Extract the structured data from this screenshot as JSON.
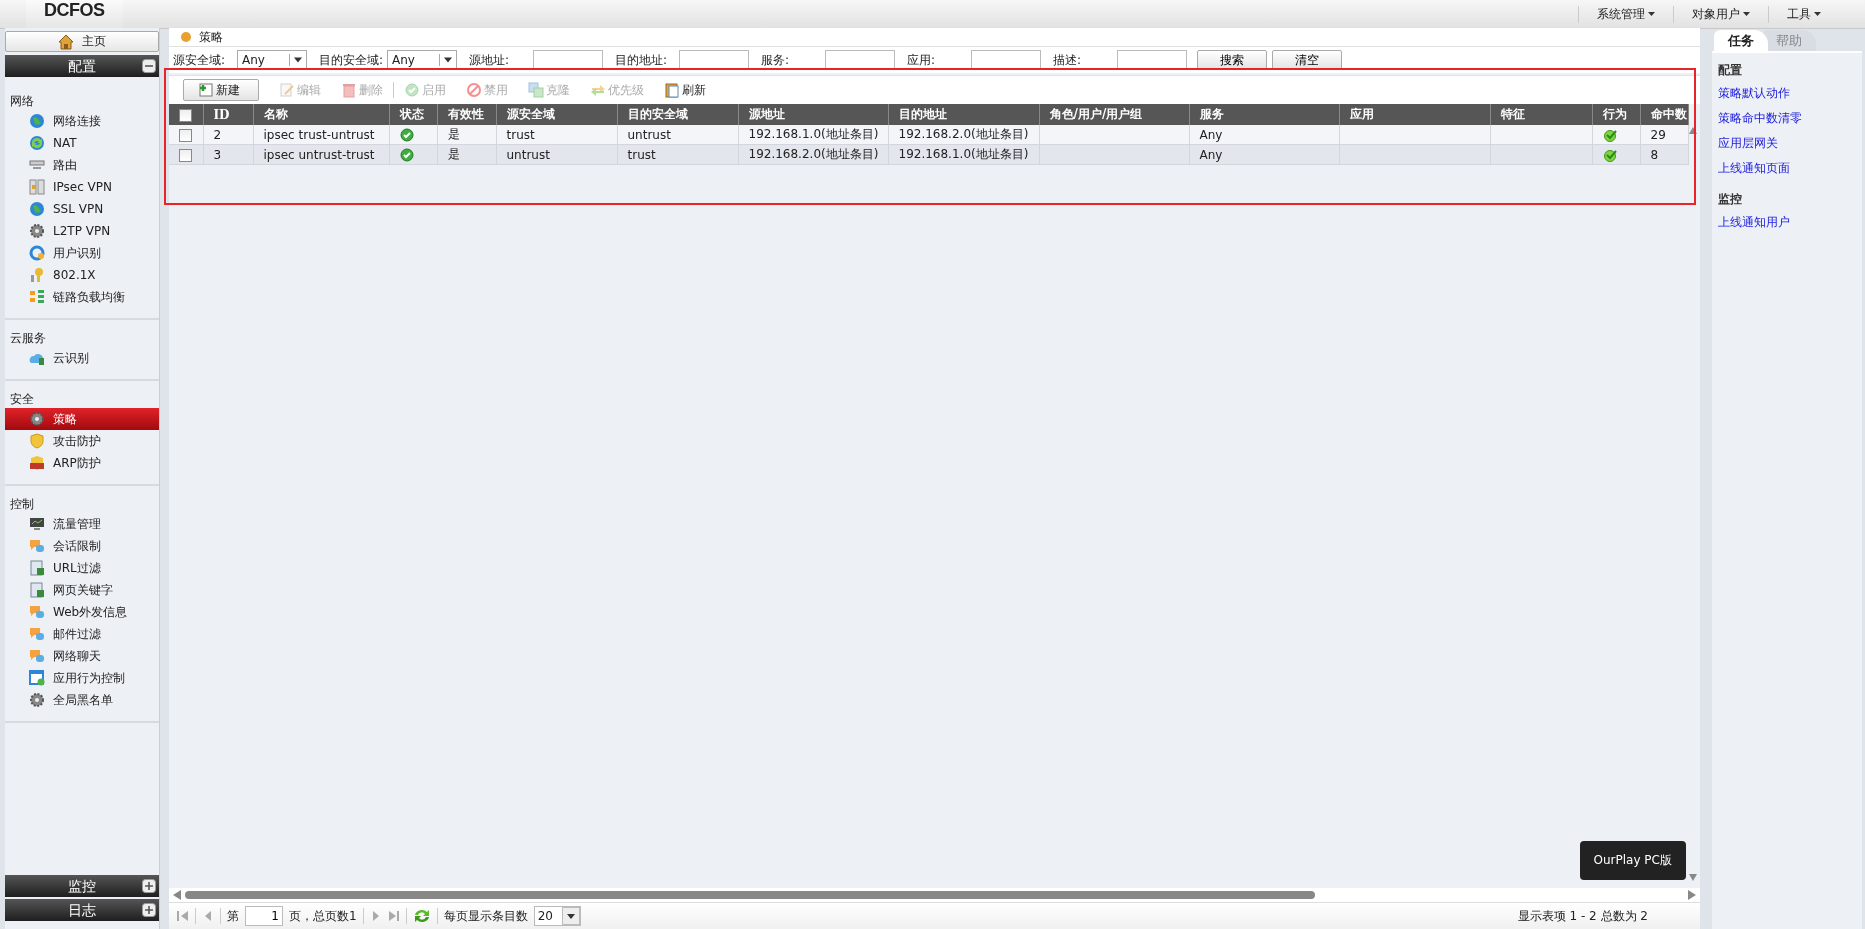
{
  "header": {
    "logo": "DCFOS",
    "menus": [
      "系统管理",
      "对象用户",
      "工具"
    ]
  },
  "sidebar": {
    "home": "主页",
    "sections": [
      {
        "title": "配置",
        "expanded": true,
        "groups": [
          {
            "title": "网络",
            "items": [
              {
                "label": "网络连接",
                "selected": false
              },
              {
                "label": "NAT",
                "selected": false
              },
              {
                "label": "路由",
                "selected": false
              },
              {
                "label": "IPsec VPN",
                "selected": false
              },
              {
                "label": "SSL VPN",
                "selected": false
              },
              {
                "label": "L2TP VPN",
                "selected": false
              },
              {
                "label": "用户识别",
                "selected": false
              },
              {
                "label": "802.1X",
                "selected": false
              },
              {
                "label": "链路负载均衡",
                "selected": false
              }
            ]
          },
          {
            "title": "云服务",
            "items": [
              {
                "label": "云识别",
                "selected": false
              }
            ]
          },
          {
            "title": "安全",
            "items": [
              {
                "label": "策略",
                "selected": true
              },
              {
                "label": "攻击防护",
                "selected": false
              },
              {
                "label": "ARP防护",
                "selected": false
              }
            ]
          },
          {
            "title": "控制",
            "items": [
              {
                "label": "流量管理",
                "selected": false
              },
              {
                "label": "会话限制",
                "selected": false
              },
              {
                "label": "URL过滤",
                "selected": false
              },
              {
                "label": "网页关键字",
                "selected": false
              },
              {
                "label": "Web外发信息",
                "selected": false
              },
              {
                "label": "邮件过滤",
                "selected": false
              },
              {
                "label": "网络聊天",
                "selected": false
              },
              {
                "label": "应用行为控制",
                "selected": false
              },
              {
                "label": "全局黑名单",
                "selected": false
              }
            ]
          }
        ]
      },
      {
        "title": "监控",
        "expanded": false
      },
      {
        "title": "日志",
        "expanded": false
      }
    ]
  },
  "breadcrumb": "策略",
  "filters": [
    {
      "label": "源安全域:",
      "kind": "select",
      "value": "Any"
    },
    {
      "label": "目的安全域:",
      "kind": "select",
      "value": "Any"
    },
    {
      "label": "源地址:",
      "kind": "text"
    },
    {
      "label": "目的地址:",
      "kind": "text"
    },
    {
      "label": "服务:",
      "kind": "text"
    },
    {
      "label": "应用:",
      "kind": "text"
    },
    {
      "label": "描述:",
      "kind": "text"
    }
  ],
  "filter_buttons": [
    "搜索",
    "清空"
  ],
  "toolbar": [
    {
      "label": "新建",
      "disabled": false
    },
    {
      "label": "编辑",
      "disabled": true
    },
    {
      "label": "删除",
      "disabled": true
    },
    {
      "label": "启用",
      "disabled": true
    },
    {
      "label": "禁用",
      "disabled": true
    },
    {
      "label": "克隆",
      "disabled": true
    },
    {
      "label": "优先级",
      "disabled": true
    },
    {
      "label": "刷新",
      "disabled": false
    }
  ],
  "table": {
    "select_all": false,
    "columns": [
      "ID",
      "名称",
      "状态",
      "有效性",
      "源安全域",
      "目的安全域",
      "源地址",
      "目的地址",
      "角色/用户/用户组",
      "服务",
      "应用",
      "特征",
      "行为",
      "命中数"
    ],
    "rows": [
      {
        "checked": false,
        "id": "2",
        "name": "ipsec trust-untrust",
        "enabled": true,
        "valid": "是",
        "src_zone": "trust",
        "dst_zone": "untrust",
        "src_addr": "192.168.1.0(地址条目)",
        "dst_addr": "192.168.2.0(地址条目)",
        "service": "Any",
        "permitted": true,
        "hits": "29"
      },
      {
        "checked": false,
        "id": "3",
        "name": "ipsec untrust-trust",
        "enabled": true,
        "valid": "是",
        "src_zone": "untrust",
        "dst_zone": "trust",
        "src_addr": "192.168.2.0(地址条目)",
        "dst_addr": "192.168.1.0(地址条目)",
        "service": "Any",
        "permitted": true,
        "hits": "8"
      }
    ]
  },
  "pager": {
    "prefix": "第",
    "page": "1",
    "total": "页，总页数1",
    "per_page_label": "每页显示条目数",
    "per_page": "20",
    "summary": "显示表项 1 - 2 总数为 2"
  },
  "task_panel": {
    "tabs": [
      {
        "label": "任务",
        "selected": true
      },
      {
        "label": "帮助",
        "selected": false
      }
    ],
    "sections": [
      {
        "title": "配置",
        "links": [
          "策略默认动作",
          "策略命中数清零",
          "应用层网关",
          "上线通知页面"
        ]
      },
      {
        "title": "监控",
        "links": [
          "上线通知用户"
        ]
      }
    ]
  },
  "popup": {
    "label": "OurPlay PC版"
  },
  "annotation_frame": true
}
